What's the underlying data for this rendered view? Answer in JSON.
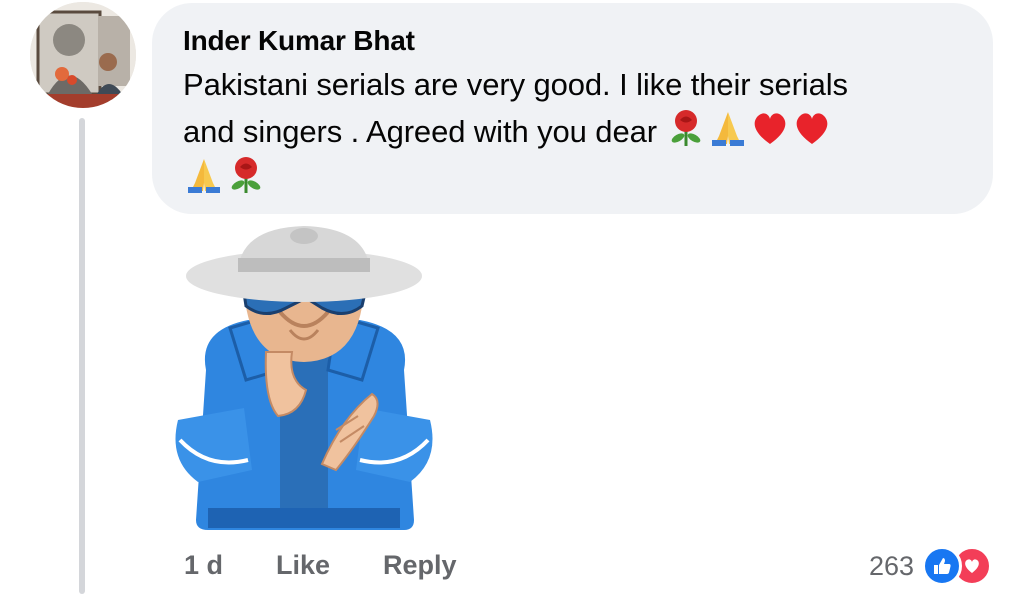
{
  "comment": {
    "author": "Inder Kumar Bhat",
    "text_line1": "Pakistani serials are very good. I like their serials",
    "text_line2": "and singers . Agreed with you dear",
    "emojis_line2": [
      "rose-icon",
      "folded-hands-icon",
      "heart-icon",
      "heart-icon"
    ],
    "emojis_line3": [
      "folded-hands-icon",
      "rose-icon"
    ],
    "sticker": "clapping-man-sticker"
  },
  "actions": {
    "time": "1 d",
    "like_label": "Like",
    "reply_label": "Reply"
  },
  "reactions": {
    "count": "263",
    "types": [
      "like-icon",
      "love-icon"
    ]
  },
  "colors": {
    "bubble": "#f0f2f5",
    "like_blue": "#1877f2",
    "love_red": "#f33e58",
    "meta_gray": "#65676b"
  }
}
